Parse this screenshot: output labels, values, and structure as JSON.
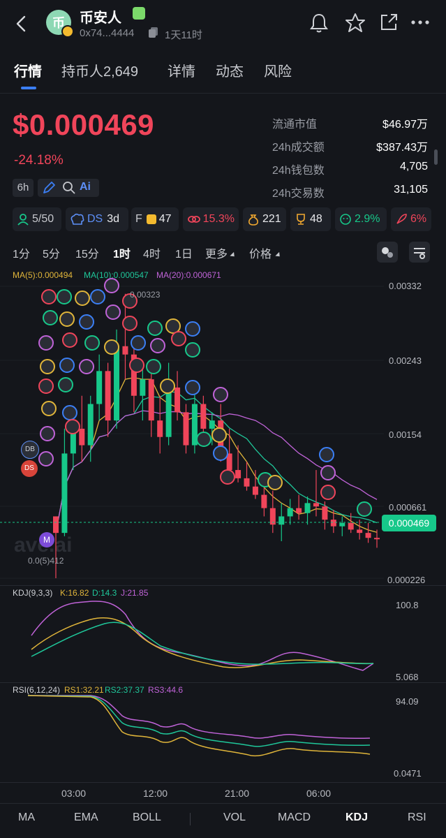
{
  "header": {
    "token_name": "币安人",
    "avatar_text": "币",
    "address": "0x74...4444",
    "age": "1天11时"
  },
  "tabs": [
    {
      "label": "行情"
    },
    {
      "label": "持币人2,649"
    },
    {
      "label": "详情"
    },
    {
      "label": "动态"
    },
    {
      "label": "风险"
    }
  ],
  "price": {
    "value": "$0.000469",
    "change": "-24.18%",
    "interval": "6h"
  },
  "stats": [
    {
      "label": "流通市值",
      "value": "$46.97万"
    },
    {
      "label": "24h成交额",
      "value": "$387.43万"
    },
    {
      "label": "24h钱包数",
      "value": "4,705"
    },
    {
      "label": "24h交易数",
      "value": "31,105"
    }
  ],
  "chips": {
    "holders": "5/50",
    "ds_label": "DS",
    "ds_value": "3d",
    "f_label": "F",
    "f_value": "47",
    "pct1": "15.3%",
    "coins": "221",
    "trophy": "48",
    "pct2": "2.9%",
    "pct3": "6%"
  },
  "timeframes": [
    "1分",
    "5分",
    "15分",
    "1时",
    "4时",
    "1日",
    "更多",
    "价格"
  ],
  "ma_legend": {
    "ma5": "MA(5):0.000494",
    "ma10": "MA(10):0.000547",
    "ma20": "MA(20):0.000671"
  },
  "price_axis": [
    "0.00332",
    "0.00243",
    "0.00154",
    "0.000661",
    "0.000226"
  ],
  "current_price_tag": "0.000469",
  "high_marker": "0.00323",
  "low_marker": "0.0(5)412",
  "watermark": "ave.ai",
  "side_badges": [
    "DB",
    "DS",
    "M"
  ],
  "kdj": {
    "title": "KDJ(9,3,3)",
    "k": "K:16.82",
    "d": "D:14.3",
    "j": "J:21.85",
    "axis": [
      "100.8",
      "5.068"
    ]
  },
  "rsi": {
    "title": "RSI(6,12,24)",
    "rs1": "RS1:32.21",
    "rs2": "RS2:37.37",
    "rs3": "RS3:44.6",
    "axis": [
      "94.09",
      "0.0471"
    ]
  },
  "time_axis": [
    "03:00",
    "12:00",
    "21:00",
    "06:00"
  ],
  "bottom_bar": [
    "MA",
    "EMA",
    "BOLL",
    "VOL",
    "MACD",
    "KDJ",
    "RSI"
  ],
  "colors": {
    "up": "#17c88a",
    "down": "#f0455a",
    "accent": "#3b7ff5",
    "ma5": "#e0b53a",
    "ma10": "#1fc79a",
    "ma20": "#c063d8"
  },
  "chart_data": {
    "type": "candlestick",
    "price_axis_ticks": [
      0.00332,
      0.00243,
      0.00154,
      0.000661,
      0.000226
    ],
    "candles": [
      {
        "o": 0.0006,
        "h": 0.0006,
        "l": 0.000226,
        "c": 0.0005
      },
      {
        "o": 0.0005,
        "h": 0.0016,
        "l": 0.00048,
        "c": 0.0013
      },
      {
        "o": 0.0013,
        "h": 0.0018,
        "l": 0.0011,
        "c": 0.0016
      },
      {
        "o": 0.0016,
        "h": 0.002,
        "l": 0.0012,
        "c": 0.0014
      },
      {
        "o": 0.0014,
        "h": 0.002,
        "l": 0.0012,
        "c": 0.0019
      },
      {
        "o": 0.0019,
        "h": 0.0025,
        "l": 0.0017,
        "c": 0.0023
      },
      {
        "o": 0.0023,
        "h": 0.0024,
        "l": 0.0015,
        "c": 0.0017
      },
      {
        "o": 0.0017,
        "h": 0.0028,
        "l": 0.0016,
        "c": 0.0026
      },
      {
        "o": 0.0026,
        "h": 0.00323,
        "l": 0.0022,
        "c": 0.0025
      },
      {
        "o": 0.0025,
        "h": 0.0027,
        "l": 0.0018,
        "c": 0.002
      },
      {
        "o": 0.002,
        "h": 0.0024,
        "l": 0.0017,
        "c": 0.0022
      },
      {
        "o": 0.0022,
        "h": 0.0023,
        "l": 0.0015,
        "c": 0.0017
      },
      {
        "o": 0.0017,
        "h": 0.002,
        "l": 0.0013,
        "c": 0.0015
      },
      {
        "o": 0.0015,
        "h": 0.0024,
        "l": 0.0014,
        "c": 0.0021
      },
      {
        "o": 0.0021,
        "h": 0.0023,
        "l": 0.0017,
        "c": 0.0018
      },
      {
        "o": 0.0018,
        "h": 0.0019,
        "l": 0.0013,
        "c": 0.0014
      },
      {
        "o": 0.0014,
        "h": 0.0021,
        "l": 0.0013,
        "c": 0.0019
      },
      {
        "o": 0.0019,
        "h": 0.002,
        "l": 0.0015,
        "c": 0.0016
      },
      {
        "o": 0.0016,
        "h": 0.0018,
        "l": 0.0014,
        "c": 0.0017
      },
      {
        "o": 0.0017,
        "h": 0.0019,
        "l": 0.0012,
        "c": 0.0013
      },
      {
        "o": 0.0013,
        "h": 0.0016,
        "l": 0.001,
        "c": 0.0011
      },
      {
        "o": 0.0011,
        "h": 0.0014,
        "l": 0.00095,
        "c": 0.001
      },
      {
        "o": 0.001,
        "h": 0.0012,
        "l": 0.00085,
        "c": 0.0009
      },
      {
        "o": 0.0009,
        "h": 0.0011,
        "l": 0.00075,
        "c": 0.0008
      },
      {
        "o": 0.0008,
        "h": 0.001,
        "l": 0.0006,
        "c": 0.00065
      },
      {
        "o": 0.00065,
        "h": 0.00085,
        "l": 0.0005,
        "c": 0.00055
      },
      {
        "o": 0.00055,
        "h": 0.0007,
        "l": 0.00045,
        "c": 0.0006
      },
      {
        "o": 0.0006,
        "h": 0.00075,
        "l": 0.00055,
        "c": 0.00065
      },
      {
        "o": 0.00065,
        "h": 0.0008,
        "l": 0.00058,
        "c": 0.00062
      },
      {
        "o": 0.00062,
        "h": 0.00078,
        "l": 0.00055,
        "c": 0.0007
      },
      {
        "o": 0.0007,
        "h": 0.0011,
        "l": 0.0006,
        "c": 0.00066
      },
      {
        "o": 0.00066,
        "h": 0.00072,
        "l": 0.00052,
        "c": 0.00058
      },
      {
        "o": 0.00058,
        "h": 0.00064,
        "l": 0.0005,
        "c": 0.00054
      },
      {
        "o": 0.00054,
        "h": 0.0006,
        "l": 0.00048,
        "c": 0.00056
      },
      {
        "o": 0.00056,
        "h": 0.00062,
        "l": 0.0005,
        "c": 0.00052
      },
      {
        "o": 0.00052,
        "h": 0.00058,
        "l": 0.00046,
        "c": 0.0005
      },
      {
        "o": 0.0005,
        "h": 0.00056,
        "l": 0.00044,
        "c": 0.00047
      },
      {
        "o": 0.00047,
        "h": 0.00052,
        "l": 0.00041,
        "c": 0.000469
      }
    ],
    "ma5_label": "MA(5):0.000494",
    "ma10_label": "MA(10):0.000547",
    "ma20_label": "MA(20):0.000671",
    "kdj_axis": [
      100.8,
      5.068
    ],
    "rsi_axis": [
      94.09,
      0.0471
    ],
    "x_ticks": [
      "03:00",
      "12:00",
      "21:00",
      "06:00"
    ]
  }
}
